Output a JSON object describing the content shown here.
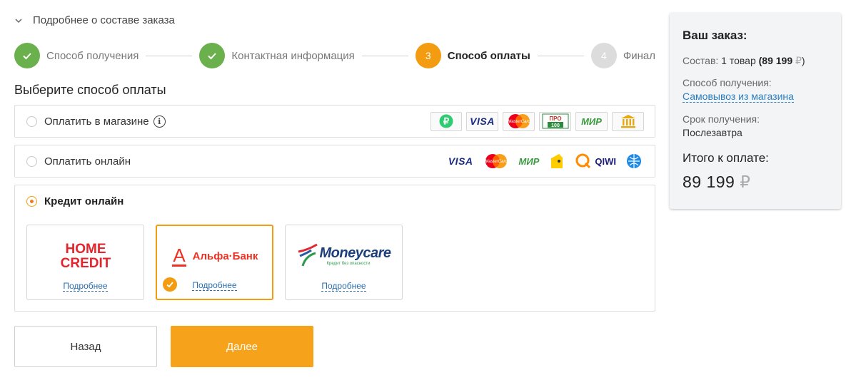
{
  "order_toggle": {
    "label": "Подробнее о составе заказа"
  },
  "steps": [
    {
      "label": "Способ получения",
      "state": "done"
    },
    {
      "label": "Контактная информация",
      "state": "done"
    },
    {
      "number": "3",
      "label": "Способ оплаты",
      "state": "current"
    },
    {
      "number": "4",
      "label": "Финал",
      "state": "future"
    }
  ],
  "section_title": "Выберите способ оплаты",
  "payment_options": [
    {
      "label": "Оплатить в магазине",
      "selected": false,
      "info_icon": "i",
      "logos": [
        "ruble-icon",
        "VISA",
        "mastercard-icon",
        "ПРО100",
        "МИР",
        "bank-icon"
      ]
    },
    {
      "label": "Оплатить онлайн",
      "selected": false,
      "logos": [
        "VISA",
        "mastercard-icon",
        "МИР",
        "yandex-money-icon",
        "QIWI",
        "webmoney-icon"
      ]
    },
    {
      "label": "Кредит онлайн",
      "selected": true
    }
  ],
  "logo_text": {
    "visa": "VISA",
    "mastercard": "MasterCard",
    "pro100_top": "ПРО",
    "pro100_bottom": "100",
    "mir": "МИР",
    "qiwi": "QIWI"
  },
  "banks": [
    {
      "name_line1": "HOME",
      "name_line2": "CREDIT",
      "more": "Подробнее",
      "selected": false
    },
    {
      "name": "Альфа·Банк",
      "mark": "А",
      "more": "Подробнее",
      "selected": true
    },
    {
      "name": "Moneycare",
      "tagline": "Кредит без опасности",
      "more": "Подробнее",
      "selected": false
    }
  ],
  "buttons": {
    "back": "Назад",
    "next": "Далее"
  },
  "summary": {
    "title": "Ваш заказ:",
    "composition_label": "Состав:",
    "composition_value": "1 товар",
    "composition_price": "(89 199",
    "composition_close": ")",
    "delivery_label": "Способ получения:",
    "delivery_value": "Самовывоз из магазина",
    "term_label": "Срок получения:",
    "term_value": "Послезавтра",
    "total_label": "Итого к оплате:",
    "total_value": "89 199",
    "currency": "₽"
  },
  "colors": {
    "accent": "#f7a21b",
    "done": "#6ab04c",
    "link": "#2a7fc1"
  }
}
